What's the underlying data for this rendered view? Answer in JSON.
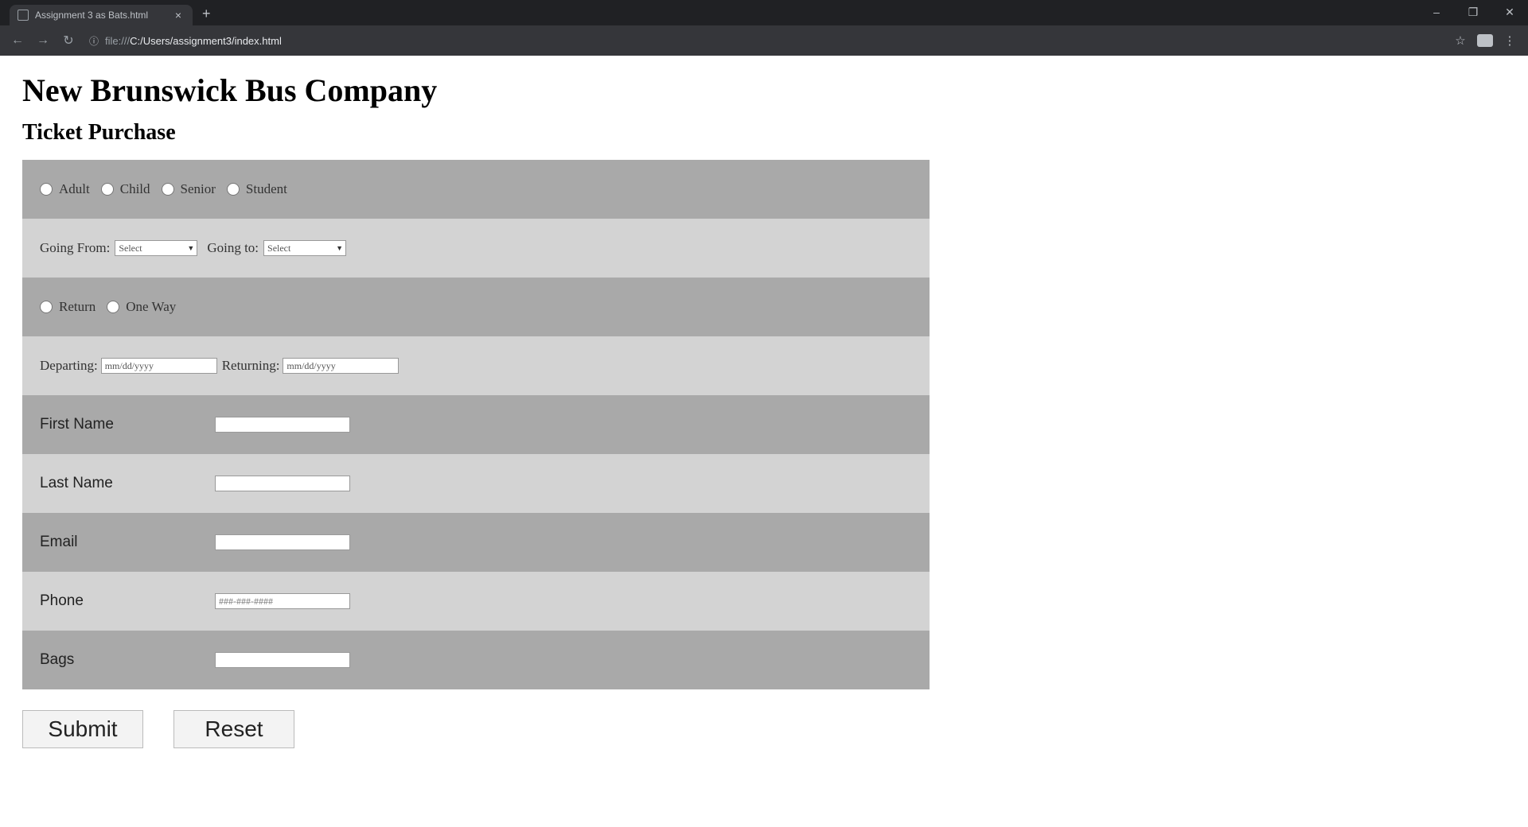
{
  "browser": {
    "tab_title": "Assignment 3 as Bats.html",
    "tab_close": "×",
    "new_tab": "+",
    "url_scheme": "file:///",
    "url_path": "C:/Users/assignment3/index.html",
    "window_controls": [
      "–",
      "❐",
      "✕"
    ]
  },
  "page": {
    "title": "New Brunswick Bus Company",
    "subtitle": "Ticket Purchase"
  },
  "form": {
    "ticket_types": [
      "Adult",
      "Child",
      "Senior",
      "Student"
    ],
    "going_from_label": "Going From:",
    "going_from_value": "Select",
    "going_to_label": "Going to:",
    "going_to_value": "Select",
    "trip_types": [
      "Return",
      "One Way"
    ],
    "departing_label": "Departing:",
    "departing_placeholder": "mm/dd/yyyy",
    "returning_label": "Returning:",
    "returning_placeholder": "mm/dd/yyyy",
    "first_name_label": "First Name",
    "last_name_label": "Last Name",
    "email_label": "Email",
    "phone_label": "Phone",
    "phone_placeholder": "###-###-####",
    "bags_label": "Bags"
  },
  "buttons": {
    "submit": "Submit",
    "reset": "Reset"
  }
}
